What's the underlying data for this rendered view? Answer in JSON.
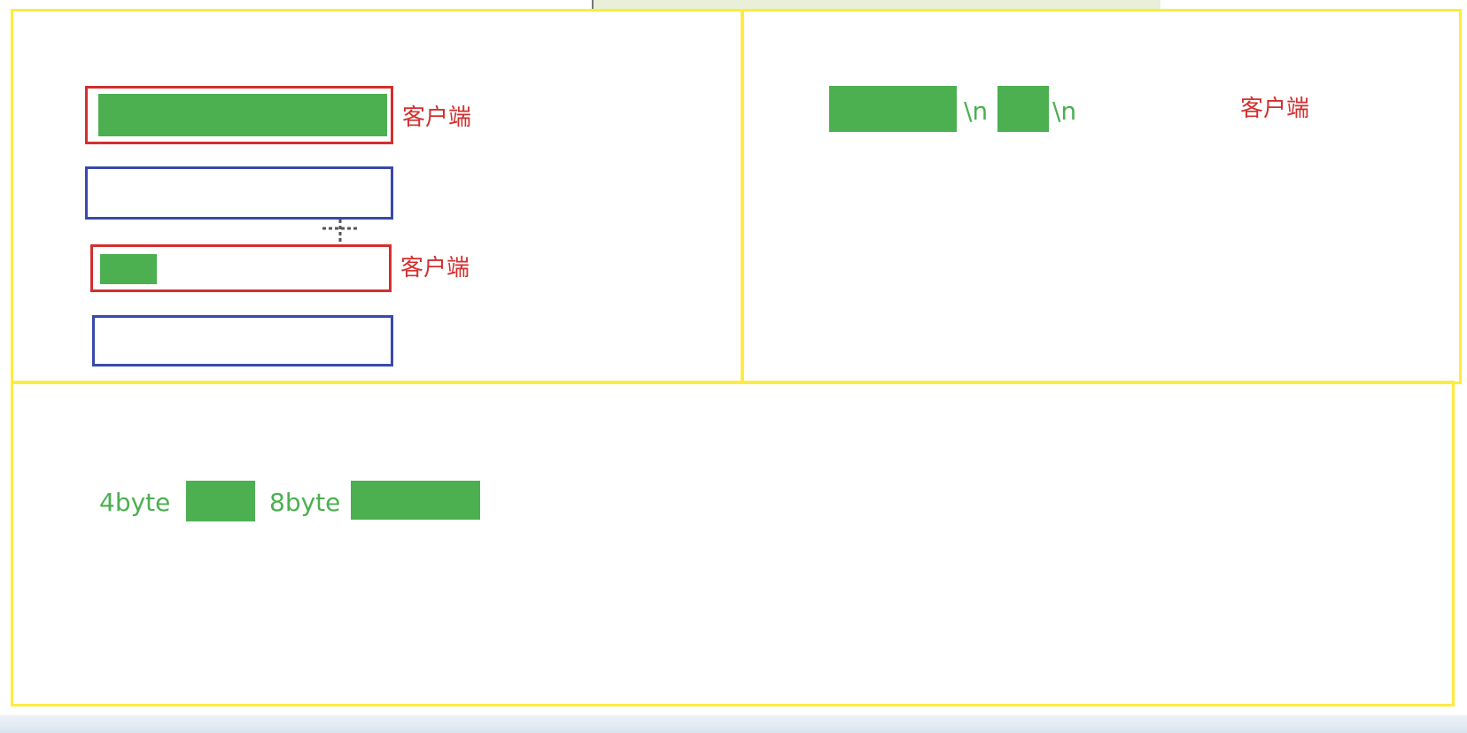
{
  "colors": {
    "panel_border": "#ffeb3b",
    "box_red": "#d32f2f",
    "box_blue": "#3949ab",
    "fill_green": "#4caf50",
    "label_red": "#d32f2f",
    "label_green": "#4caf50"
  },
  "top_left": {
    "label_1": "客户端",
    "label_2": "客户端"
  },
  "top_right": {
    "sep_1": "\\n",
    "sep_2": "\\n",
    "label": "客户端"
  },
  "bottom": {
    "label_4byte": "4byte",
    "label_8byte": "8byte"
  },
  "cursor_icon": "move-crosshair-icon"
}
